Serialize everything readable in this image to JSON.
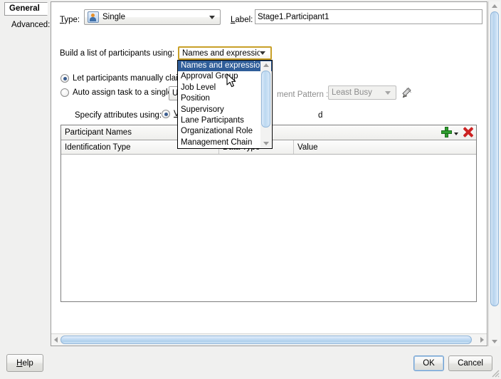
{
  "tabs": [
    {
      "label": "General",
      "selected": true
    },
    {
      "label": "Advanced:",
      "selected": false
    }
  ],
  "form": {
    "type_label": "Type:",
    "type_label_mnemonic": "T",
    "type_value": "Single",
    "type_icon": "single-participant-icon",
    "label_label": "Label:",
    "label_label_mnemonic": "L",
    "label_value": "Stage1.Participant1",
    "build_list_label": "Build a list of participants using:",
    "build_list_value": "Names and expressions",
    "radio_claim_label": "Let participants manually claim",
    "radio_claim_checked": true,
    "radio_auto_label": "Auto assign task to a single",
    "radio_auto_checked": false,
    "auto_target_value": "Us",
    "assignment_pattern_label": "ment Pattern :",
    "assignment_pattern_value": "Least Busy",
    "specify_attributes_label": "Specify attributes using:",
    "specify_radio_value": "V",
    "specify_trailing_text": "d"
  },
  "dropdown": {
    "open": true,
    "options": [
      "Names and expressions",
      "Approval Group",
      "Job Level",
      "Position",
      "Supervisory",
      "Lane Participants",
      "Organizational Role",
      "Management Chain"
    ],
    "selected_index": 0,
    "hovered_index": 1
  },
  "table": {
    "title": "Participant Names",
    "columns": [
      "Identification Type",
      "Data Type",
      "Value"
    ],
    "rows": [],
    "add_icon": "add-plus-icon",
    "add_dropdown_icon": "chevron-down-icon",
    "delete_icon": "delete-x-icon"
  },
  "edit_icon": "pencil-edit-icon",
  "footer": {
    "help_label": "Help",
    "help_mnemonic": "H",
    "ok_label": "OK",
    "cancel_label": "Cancel"
  },
  "colors": {
    "selection_blue": "#2f5d99",
    "focus_gold": "#c8a028",
    "add_green": "#2f9e2f",
    "delete_red": "#cc2222",
    "scroll_blue": "#b6d3ee"
  }
}
